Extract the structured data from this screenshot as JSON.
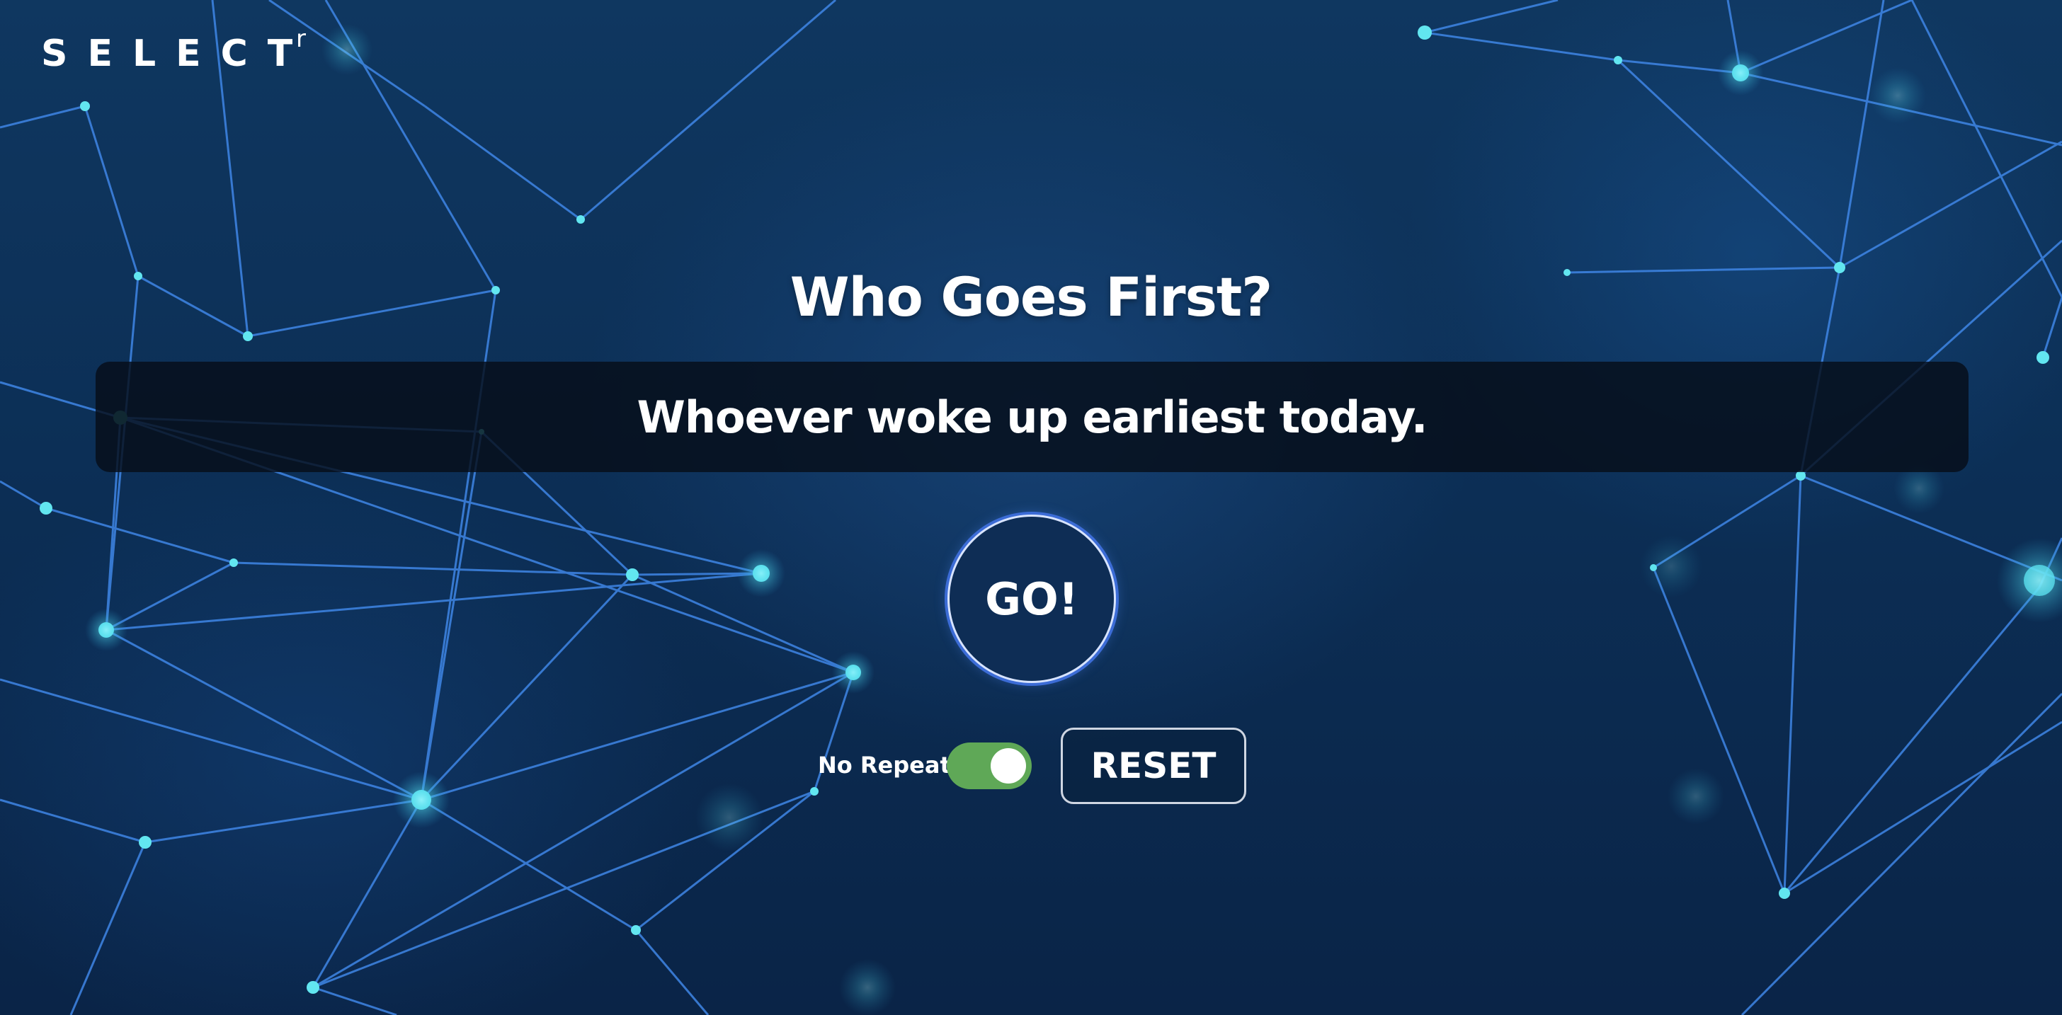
{
  "brand": {
    "logo_text": "SELECT",
    "logo_sup": "r"
  },
  "main": {
    "title": "Who Goes First?",
    "result": "Whoever woke up earliest today.",
    "go_label": "GO!"
  },
  "controls": {
    "no_repeat_label": "No Repeat",
    "no_repeat_on": true,
    "reset_label": "RESET"
  },
  "colors": {
    "background": "#0c2f56",
    "panel": "#060e18",
    "toggle_on": "#5fa857",
    "network_line": "#3f86e6",
    "network_node": "#62e6f0"
  }
}
